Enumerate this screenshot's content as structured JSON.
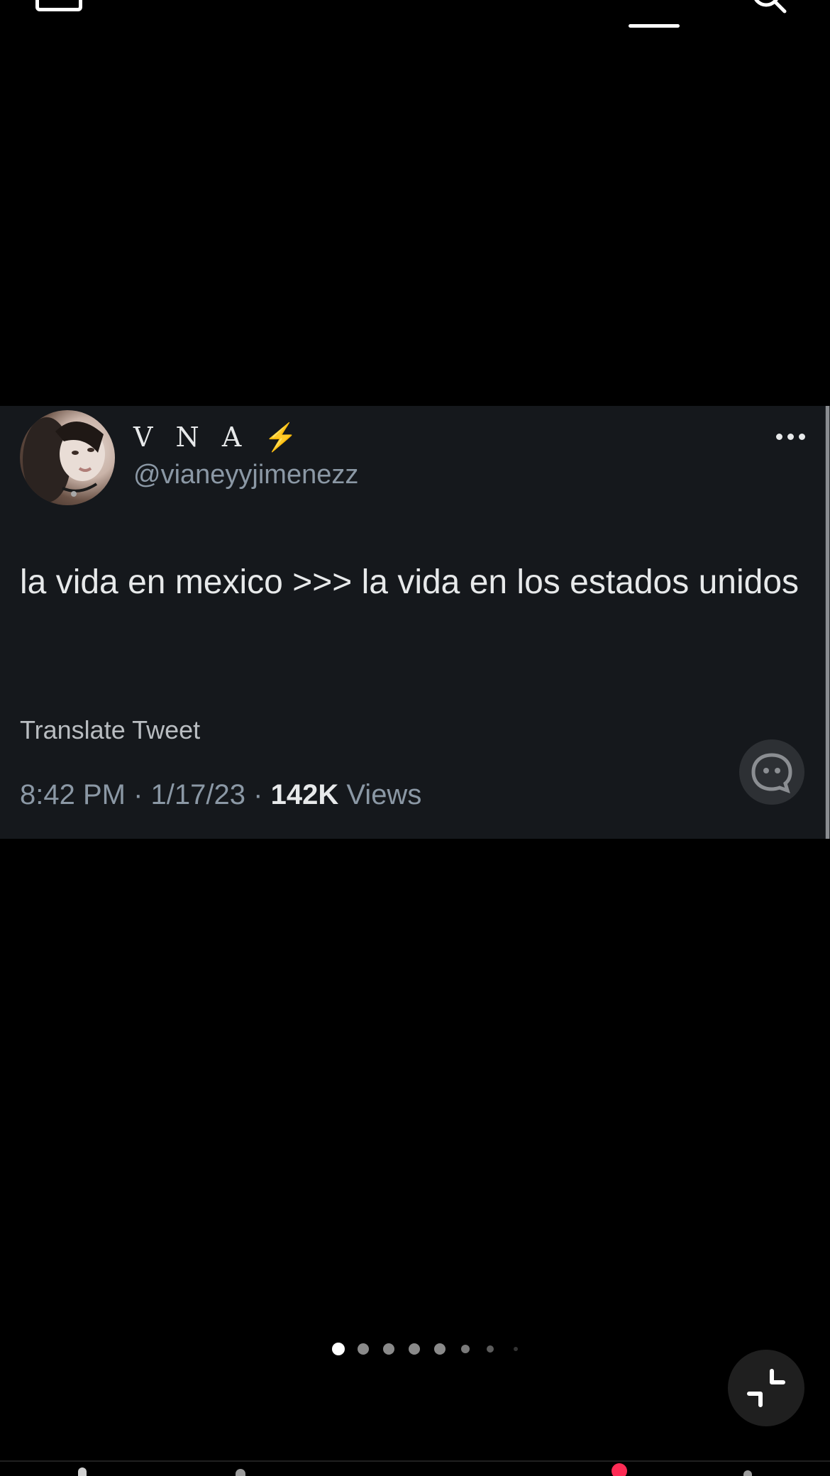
{
  "tweet": {
    "display_name": "V N A",
    "badge_emoji": "⚡",
    "handle": "@vianeyyjimenezz",
    "text": "la vida en mexico >>> la vida en los estados unidos",
    "translate_label": "Translate Tweet",
    "time": "8:42 PM",
    "date": "1/17/23",
    "separator": "·",
    "views_count": "142K",
    "views_label": "Views"
  },
  "carousel": {
    "total_dots": 8,
    "active_index": 0
  },
  "colors": {
    "background": "#000000",
    "card": "#15181c",
    "primary_text": "#e7e9ea",
    "secondary_text": "#8b98a5",
    "bolt": "#f5c33b",
    "notification": "#fe2c55"
  },
  "icons": {
    "menu": "menu-icon",
    "search": "search-icon",
    "more": "more-options-icon",
    "chat": "chat-bubble-icon",
    "collapse": "collapse-icon"
  }
}
